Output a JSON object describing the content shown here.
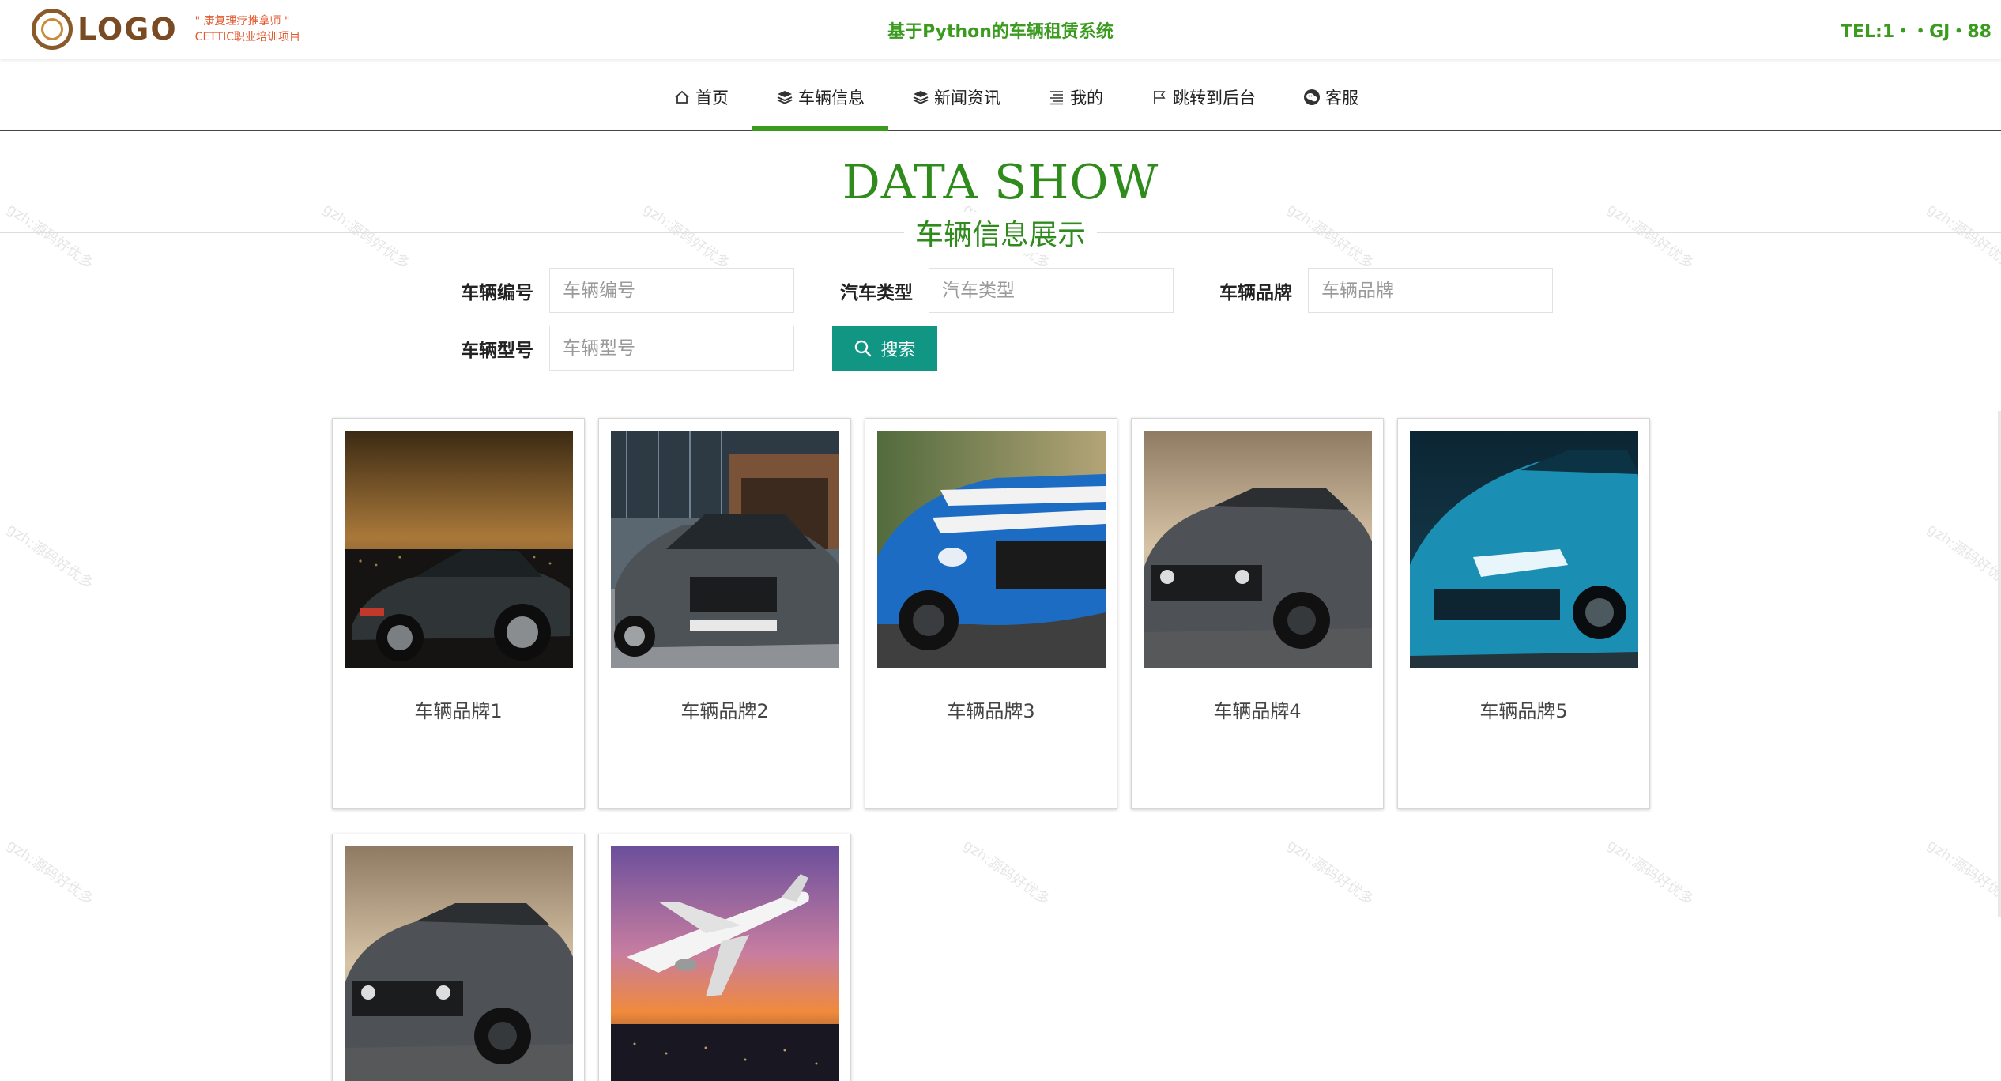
{
  "header": {
    "logo_text": "LOGO",
    "logo_sub_1": "\" 康复理疗推拿师 \"",
    "logo_sub_2": "CETTIC职业培训项目",
    "site_title": "基于Python的车辆租赁系统",
    "tel": "TEL:1・・GJ・88"
  },
  "nav": {
    "items": [
      {
        "label": "首页",
        "icon": "home-icon"
      },
      {
        "label": "车辆信息",
        "icon": "layers-icon"
      },
      {
        "label": "新闻资讯",
        "icon": "layers-icon"
      },
      {
        "label": "我的",
        "icon": "list-icon"
      },
      {
        "label": "跳转到后台",
        "icon": "flag-icon"
      },
      {
        "label": "客服",
        "icon": "chat-icon"
      }
    ],
    "active_index": 1
  },
  "section": {
    "title": "DATA SHOW",
    "subtitle": "车辆信息展示"
  },
  "search": {
    "fields": [
      {
        "label": "车辆编号",
        "placeholder": "车辆编号"
      },
      {
        "label": "汽车类型",
        "placeholder": "汽车类型"
      },
      {
        "label": "车辆品牌",
        "placeholder": "车辆品牌"
      },
      {
        "label": "车辆型号",
        "placeholder": "车辆型号"
      }
    ],
    "button_label": "搜索"
  },
  "cards": [
    {
      "caption": "车辆品牌1",
      "image": "dark-sports-car-photo"
    },
    {
      "caption": "车辆品牌2",
      "image": "silver-sedan-photo"
    },
    {
      "caption": "车辆品牌3",
      "image": "blue-muscle-car-photo"
    },
    {
      "caption": "车辆品牌4",
      "image": "grey-muscle-car-photo"
    },
    {
      "caption": "车辆品牌5",
      "image": "blue-concept-car-photo"
    },
    {
      "caption": "",
      "image": "grey-muscle-car-photo"
    },
    {
      "caption": "",
      "image": "airplane-sunset-photo"
    }
  ],
  "watermark": "gzh:源码好优多",
  "colors": {
    "brand_green": "#3a9b1f",
    "title_green": "#2e8b1c",
    "search_button": "#119684"
  }
}
